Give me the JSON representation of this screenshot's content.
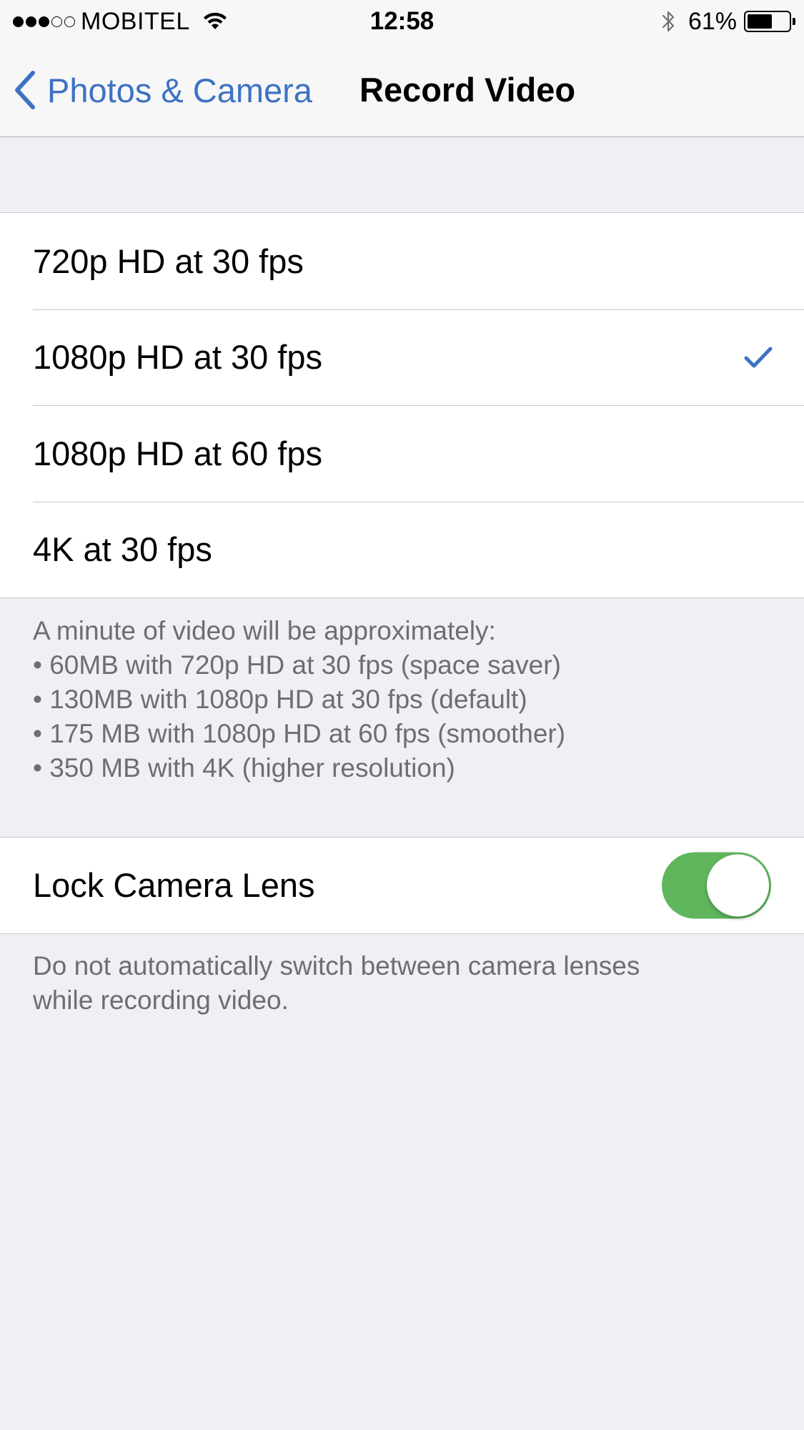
{
  "status_bar": {
    "signal_bars": {
      "filled": 3,
      "total": 5
    },
    "carrier": "MOBITEL",
    "wifi_icon": "wifi-icon",
    "time": "12:58",
    "bluetooth_icon": "bluetooth-icon",
    "battery_percent_label": "61%",
    "battery_level": 0.61
  },
  "nav": {
    "back_label": "Photos & Camera",
    "back_icon": "chevron-left-icon",
    "title": "Record Video"
  },
  "options": [
    {
      "label": "720p HD at 30 fps",
      "selected": false
    },
    {
      "label": "1080p HD at 30 fps",
      "selected": true
    },
    {
      "label": "1080p HD at 60 fps",
      "selected": false
    },
    {
      "label": "4K at 30 fps",
      "selected": false
    }
  ],
  "options_footer": [
    "A minute of video will be approximately:",
    "• 60MB with 720p HD at 30 fps (space saver)",
    "• 130MB with 1080p HD at 30 fps (default)",
    "• 175 MB with 1080p HD at 60 fps (smoother)",
    "• 350 MB with 4K (higher resolution)"
  ],
  "lock_lens": {
    "label": "Lock Camera Lens",
    "enabled": true,
    "footer": [
      "Do not automatically switch between camera lenses",
      "while recording video."
    ]
  },
  "colors": {
    "accent": "#3c72c4",
    "toggle_on": "#5fb65d",
    "background": "#efeff4",
    "footer_text": "#6d6d72"
  }
}
